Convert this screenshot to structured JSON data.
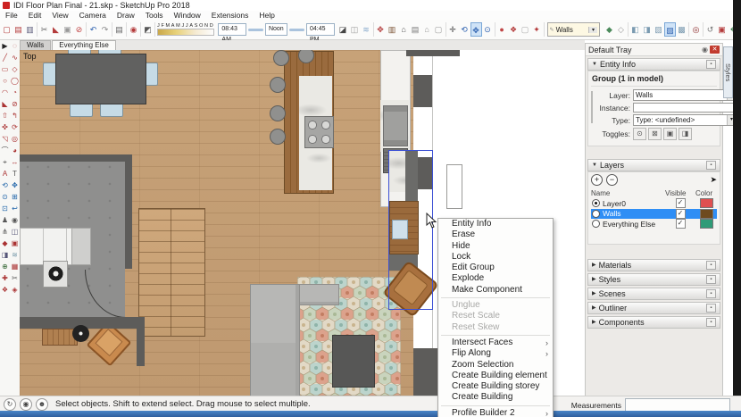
{
  "window": {
    "title": "IDI Floor Plan Final - 21.skp - SketchUp Pro 2018"
  },
  "menu_bar": [
    "File",
    "Edit",
    "View",
    "Camera",
    "Draw",
    "Tools",
    "Window",
    "Extensions",
    "Help"
  ],
  "toolbar": {
    "months": "JFMAMJJASOND",
    "time_start": "08:43 AM",
    "time_mid": "Noon",
    "time_end": "04:45 PM",
    "layer_dropdown": "Walls",
    "groups_a": [
      [
        {
          "n": "new",
          "g": "▢",
          "c": "#b33a3a"
        },
        {
          "n": "open",
          "g": "▤",
          "c": "#b33a3a"
        },
        {
          "n": "save",
          "g": "▥",
          "c": "#5a5a7a"
        }
      ],
      [
        {
          "n": "knife",
          "g": "✂",
          "c": "#666666"
        },
        {
          "n": "paint-bucket",
          "g": "◣",
          "c": "#b33a3a"
        },
        {
          "n": "box",
          "g": "▣",
          "c": "#999999"
        },
        {
          "n": "circle-slash",
          "g": "⊘",
          "c": "#c04040"
        }
      ],
      [
        {
          "n": "undo",
          "g": "↶",
          "c": "#2b5fae"
        },
        {
          "n": "redo",
          "g": "↷",
          "c": "#888888"
        }
      ],
      [
        {
          "n": "print",
          "g": "▤",
          "c": "#666666"
        }
      ],
      [
        {
          "n": "model-info",
          "g": "◉",
          "c": "#b33a3a"
        }
      ],
      [
        {
          "n": "shadow-settings",
          "g": "◩",
          "c": "#555555"
        }
      ]
    ],
    "groups_b": [
      [
        {
          "n": "shadow-toggle",
          "g": "◪",
          "c": "#444444"
        },
        {
          "n": "ground-shadows",
          "g": "◫",
          "c": "#999999"
        },
        {
          "n": "soften-edges",
          "g": "≋",
          "c": "#88aacc"
        }
      ],
      [
        {
          "n": "position-texture",
          "g": "✥",
          "c": "#b33a3a"
        },
        {
          "n": "cabinet",
          "g": "▥",
          "c": "#7a5232"
        },
        {
          "n": "home",
          "g": "⌂",
          "c": "#555555"
        },
        {
          "n": "printer",
          "g": "▤",
          "c": "#777777"
        },
        {
          "n": "house-outline",
          "g": "⌂",
          "c": "#999999"
        },
        {
          "n": "crate",
          "g": "▢",
          "c": "#999999"
        }
      ],
      [
        {
          "n": "previous-view",
          "g": "✛",
          "c": "#444444"
        },
        {
          "n": "orbit",
          "g": "⟲",
          "c": "#2b5fae"
        },
        {
          "n": "pan",
          "g": "✥",
          "c": "#2b5fae",
          "sel": true
        },
        {
          "n": "zoom",
          "g": "⊙",
          "c": "#2b5fae"
        }
      ],
      [
        {
          "n": "sphere",
          "g": "●",
          "c": "#c04545"
        },
        {
          "n": "material-sampler",
          "g": "❖",
          "c": "#b33a3a"
        },
        {
          "n": "blank-tool",
          "g": "▢",
          "c": "#aaaaaa"
        },
        {
          "n": "red-tool",
          "g": "✦",
          "c": "#b33a3a"
        }
      ]
    ],
    "groups_c": [
      [
        {
          "n": "polygon-green",
          "g": "◆",
          "c": "#4a8a5a"
        },
        {
          "n": "polygon-white",
          "g": "◇",
          "c": "#999999"
        }
      ],
      [
        {
          "n": "face-style-1",
          "g": "◧",
          "c": "#7a9ab0"
        },
        {
          "n": "face-style-2",
          "g": "◨",
          "c": "#7a9ab0"
        },
        {
          "n": "face-style-3",
          "g": "▧",
          "c": "#7a9ab0"
        },
        {
          "n": "face-style-4",
          "g": "▨",
          "c": "#2b5fae",
          "sel": true
        },
        {
          "n": "face-style-5",
          "g": "▩",
          "c": "#7a9ab0"
        }
      ],
      [
        {
          "n": "target",
          "g": "◎",
          "c": "#8a2626"
        }
      ],
      [
        {
          "n": "rollback",
          "g": "↺",
          "c": "#777777"
        },
        {
          "n": "tool-red",
          "g": "▣",
          "c": "#b33a3a"
        },
        {
          "n": "tool-green",
          "g": "❖",
          "c": "#3f7f4f"
        }
      ]
    ]
  },
  "scene_tabs": [
    {
      "label": "Walls",
      "active": false
    },
    {
      "label": "Everything Else",
      "active": true
    }
  ],
  "left_palette": [
    {
      "n": "select",
      "g": "▶",
      "c": "#222222"
    },
    {
      "n": "lasso",
      "g": "◌",
      "c": "#aa3333"
    },
    {
      "n": "line",
      "g": "╱",
      "c": "#aa3333"
    },
    {
      "n": "freehand",
      "g": "∿",
      "c": "#aa3333"
    },
    {
      "n": "rectangle",
      "g": "▭",
      "c": "#aa3333"
    },
    {
      "n": "rotated-rectangle",
      "g": "◇",
      "c": "#aa3333"
    },
    {
      "n": "circle",
      "g": "○",
      "c": "#aa3333"
    },
    {
      "n": "polygon",
      "g": "◯",
      "c": "#aa3333"
    },
    {
      "n": "arc",
      "g": "◠",
      "c": "#aa3333"
    },
    {
      "n": "pie",
      "g": "◔",
      "c": "#aa3333"
    },
    {
      "n": "paint",
      "g": "◣",
      "c": "#aa3333"
    },
    {
      "n": "eraser",
      "g": "⊘",
      "c": "#aa3333"
    },
    {
      "n": "push-pull",
      "g": "⇧",
      "c": "#aa3333"
    },
    {
      "n": "follow-me",
      "g": "↰",
      "c": "#aa3333"
    },
    {
      "n": "move",
      "g": "✜",
      "c": "#aa3333"
    },
    {
      "n": "rotate",
      "g": "⟳",
      "c": "#aa3333"
    },
    {
      "n": "scale",
      "g": "◹",
      "c": "#aa3333"
    },
    {
      "n": "offset",
      "g": "◎",
      "c": "#aa3333"
    },
    {
      "n": "tape-measure",
      "g": "⌒",
      "c": "#555555"
    },
    {
      "n": "protractor",
      "g": "◕",
      "c": "#aa3333"
    },
    {
      "n": "axes",
      "g": "⌖",
      "c": "#555555"
    },
    {
      "n": "dimension",
      "g": "↔",
      "c": "#aa3333"
    },
    {
      "n": "text",
      "g": "A",
      "c": "#aa3333"
    },
    {
      "n": "3d-text",
      "g": "T",
      "c": "#555555"
    },
    {
      "n": "orbit",
      "g": "⟲",
      "c": "#2266aa"
    },
    {
      "n": "pan",
      "g": "✥",
      "c": "#2266aa"
    },
    {
      "n": "zoom",
      "g": "⊙",
      "c": "#2266aa"
    },
    {
      "n": "zoom-window",
      "g": "⊞",
      "c": "#2266aa"
    },
    {
      "n": "zoom-extents",
      "g": "⊡",
      "c": "#2266aa"
    },
    {
      "n": "previous",
      "g": "↩",
      "c": "#2266aa"
    },
    {
      "n": "position-camera",
      "g": "♟",
      "c": "#555555"
    },
    {
      "n": "look-around",
      "g": "◉",
      "c": "#555555"
    },
    {
      "n": "walk",
      "g": "⋔",
      "c": "#555555"
    },
    {
      "n": "section-plane",
      "g": "◫",
      "c": "#555577"
    },
    {
      "n": "component",
      "g": "◆",
      "c": "#aa3333"
    },
    {
      "n": "group",
      "g": "▣",
      "c": "#aa3333"
    },
    {
      "n": "shadows",
      "g": "◨",
      "c": "#555577"
    },
    {
      "n": "fog",
      "g": "≋",
      "c": "#7799aa"
    },
    {
      "n": "add-location",
      "g": "⊕",
      "c": "#336633"
    },
    {
      "n": "texture",
      "g": "▦",
      "c": "#aa3333"
    },
    {
      "n": "extension-a",
      "g": "✚",
      "c": "#aa3333"
    },
    {
      "n": "extension-b",
      "g": "✂",
      "c": "#555555"
    },
    {
      "n": "extension-c",
      "g": "❖",
      "c": "#aa3333"
    },
    {
      "n": "extension-d",
      "g": "◈",
      "c": "#aa3333"
    }
  ],
  "canvas": {
    "view_label": "Top"
  },
  "context_menu": {
    "items": [
      {
        "label": "Entity Info"
      },
      {
        "label": "Erase"
      },
      {
        "label": "Hide"
      },
      {
        "label": "Lock"
      },
      {
        "label": "Edit Group"
      },
      {
        "label": "Explode"
      },
      {
        "label": "Make Component"
      },
      {
        "separator": true
      },
      {
        "label": "Unglue",
        "disabled": true
      },
      {
        "label": "Reset Scale",
        "disabled": true
      },
      {
        "label": "Reset Skew",
        "disabled": true
      },
      {
        "separator": true
      },
      {
        "label": "Intersect Faces",
        "submenu": true
      },
      {
        "label": "Flip Along",
        "submenu": true
      },
      {
        "label": "Zoom Selection"
      },
      {
        "label": "Create Building element"
      },
      {
        "label": "Create Building storey"
      },
      {
        "label": "Create Building"
      },
      {
        "separator": true
      },
      {
        "label": "Profile Builder 2",
        "submenu": true
      }
    ]
  },
  "tray": {
    "title": "Default Tray",
    "side_tab": "Styles",
    "entity_info": {
      "header": "Entity Info",
      "group_label": "Group (1 in model)",
      "layer_label": "Layer:",
      "layer_value": "Walls",
      "instance_label": "Instance:",
      "instance_value": "",
      "type_label": "Type:",
      "type_value": "Type: <undefined>",
      "toggles_label": "Toggles:",
      "toggles": [
        {
          "n": "hidden",
          "g": "⊙"
        },
        {
          "n": "locked",
          "g": "⊠"
        },
        {
          "n": "receive-shadows",
          "g": "▣"
        },
        {
          "n": "cast-shadows",
          "g": "◨"
        }
      ]
    },
    "layers": {
      "header": "Layers",
      "columns": [
        "Name",
        "Visible",
        "Color"
      ],
      "rows": [
        {
          "name": "Layer0",
          "radio": true,
          "visible": true,
          "color": "#e05050",
          "selected": false
        },
        {
          "name": "Walls",
          "radio": false,
          "visible": true,
          "color": "#6e4a1f",
          "selected": true
        },
        {
          "name": "Everything Else",
          "radio": false,
          "visible": true,
          "color": "#2f9b77",
          "selected": false
        }
      ]
    },
    "collapsed_sections": [
      "Materials",
      "Styles",
      "Scenes",
      "Outliner",
      "Components"
    ]
  },
  "status_bar": {
    "icons": [
      {
        "n": "refresh",
        "g": "↻"
      },
      {
        "n": "geolocation",
        "g": "◉"
      },
      {
        "n": "user",
        "g": "☻"
      }
    ],
    "hint": "Select objects. Shift to extend select. Drag mouse to select multiple.",
    "measurements_label": "Measurements",
    "measurements_value": ""
  }
}
